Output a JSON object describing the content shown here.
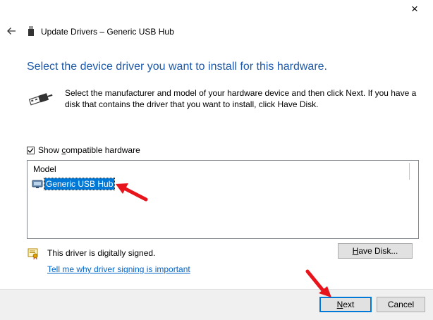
{
  "window": {
    "title": "Update Drivers – Generic USB Hub",
    "close_glyph": "×"
  },
  "main": {
    "heading": "Select the device driver you want to install for this hardware.",
    "description": "Select the manufacturer and model of your hardware device and then click Next. If you have a disk that contains the driver that you want to install, click Have Disk."
  },
  "compatible": {
    "label_pre": "Show ",
    "label_accel": "c",
    "label_post": "ompatible hardware",
    "checked": true
  },
  "model_list": {
    "header": "Model",
    "items": [
      {
        "label": "Generic USB Hub",
        "selected": true
      }
    ]
  },
  "signing": {
    "status_text": "This driver is digitally signed.",
    "link_text": "Tell me why driver signing is important"
  },
  "buttons": {
    "have_disk_accel": "H",
    "have_disk_rest": "ave Disk...",
    "next_accel": "N",
    "next_rest": "ext",
    "cancel": "Cancel"
  },
  "colors": {
    "heading": "#1f5aa8",
    "selection": "#0078d7",
    "link": "#0066cc",
    "annotation_arrow": "#e8141b"
  },
  "icons": {
    "back": "back-arrow-icon",
    "title": "usb-device-icon",
    "usb_plug": "usb-plug-icon",
    "hub_item": "usb-hub-icon",
    "signed": "signed-driver-certificate-icon"
  }
}
